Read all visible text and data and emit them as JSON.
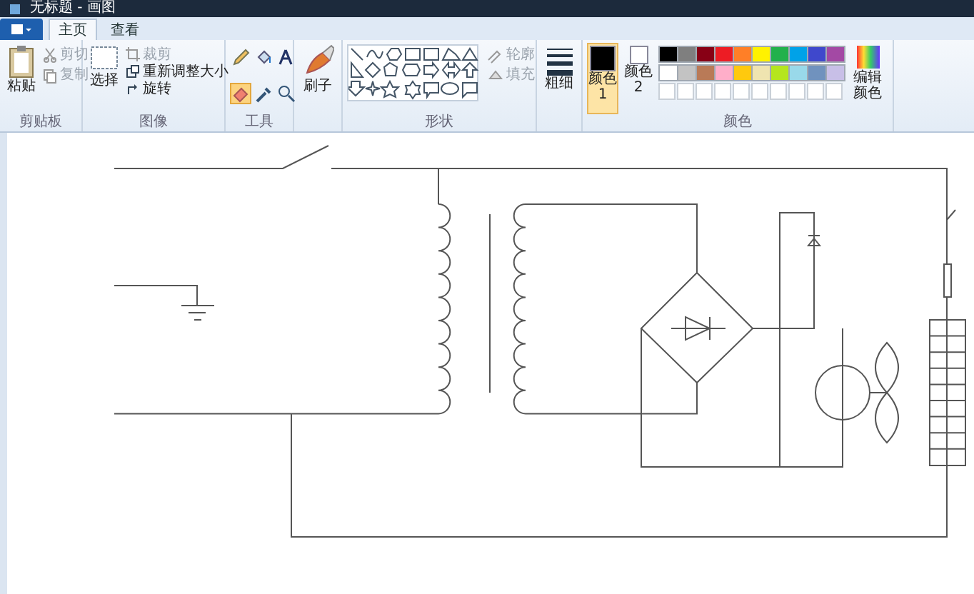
{
  "window": {
    "title": "无标题 - 画图"
  },
  "tabs": [
    {
      "label": "主页",
      "selected": true
    },
    {
      "label": "查看",
      "selected": false
    }
  ],
  "ribbon": {
    "clipboard": {
      "group_label": "剪贴板",
      "paste": "粘贴",
      "items": [
        {
          "kind": "cut",
          "label": "剪切",
          "disabled": true
        },
        {
          "kind": "copy",
          "label": "复制",
          "disabled": true
        }
      ]
    },
    "image": {
      "group_label": "图像",
      "select": "选择",
      "items": [
        {
          "kind": "crop",
          "label": "裁剪",
          "disabled": true
        },
        {
          "kind": "resize",
          "label": "重新调整大小",
          "disabled": false
        },
        {
          "kind": "rotate",
          "label": "旋转",
          "disabled": false
        }
      ]
    },
    "tools": {
      "group_label": "工具",
      "items": [
        {
          "kind": "pencil",
          "selected": false
        },
        {
          "kind": "fill",
          "selected": false
        },
        {
          "kind": "text",
          "selected": false
        },
        {
          "kind": "eraser",
          "selected": true
        },
        {
          "kind": "picker",
          "selected": false
        },
        {
          "kind": "magnifier",
          "selected": false
        }
      ]
    },
    "brushes": {
      "label": "刷子"
    },
    "shapes": {
      "group_label": "形状",
      "options": [
        {
          "kind": "outline",
          "label": "轮廓",
          "disabled": true
        },
        {
          "kind": "fill",
          "label": "填充",
          "disabled": true
        }
      ]
    },
    "size": {
      "label": "粗细"
    },
    "colors": {
      "group_label": "颜色",
      "slots": [
        {
          "label": "颜色 1",
          "selected": true,
          "color": "#000000"
        },
        {
          "label": "颜色 2",
          "selected": false,
          "color": "#ffffff"
        }
      ],
      "palette": [
        {
          "kind": "swatch",
          "color": "#000000"
        },
        {
          "kind": "swatch",
          "color": "#7f7f7f"
        },
        {
          "kind": "swatch",
          "color": "#880015"
        },
        {
          "kind": "swatch",
          "color": "#ed1c24"
        },
        {
          "kind": "swatch",
          "color": "#ff7f27"
        },
        {
          "kind": "swatch",
          "color": "#fff200"
        },
        {
          "kind": "swatch",
          "color": "#22b14c"
        },
        {
          "kind": "swatch",
          "color": "#00a2e8"
        },
        {
          "kind": "swatch",
          "color": "#3f48cc"
        },
        {
          "kind": "swatch",
          "color": "#a349a4"
        },
        {
          "kind": "swatch",
          "color": "#ffffff"
        },
        {
          "kind": "swatch",
          "color": "#c3c3c3"
        },
        {
          "kind": "swatch",
          "color": "#b97a57"
        },
        {
          "kind": "swatch",
          "color": "#ffaec9"
        },
        {
          "kind": "swatch",
          "color": "#ffc90e"
        },
        {
          "kind": "swatch",
          "color": "#efe4b0"
        },
        {
          "kind": "swatch",
          "color": "#b5e61d"
        },
        {
          "kind": "swatch",
          "color": "#99d9ea"
        },
        {
          "kind": "swatch",
          "color": "#7092be"
        },
        {
          "kind": "swatch",
          "color": "#c8bfe7"
        },
        {
          "kind": "empty"
        },
        {
          "kind": "empty"
        },
        {
          "kind": "empty"
        },
        {
          "kind": "empty"
        },
        {
          "kind": "empty"
        },
        {
          "kind": "empty"
        },
        {
          "kind": "empty"
        },
        {
          "kind": "empty"
        },
        {
          "kind": "empty"
        },
        {
          "kind": "empty"
        }
      ],
      "edit": "编辑颜色"
    }
  }
}
